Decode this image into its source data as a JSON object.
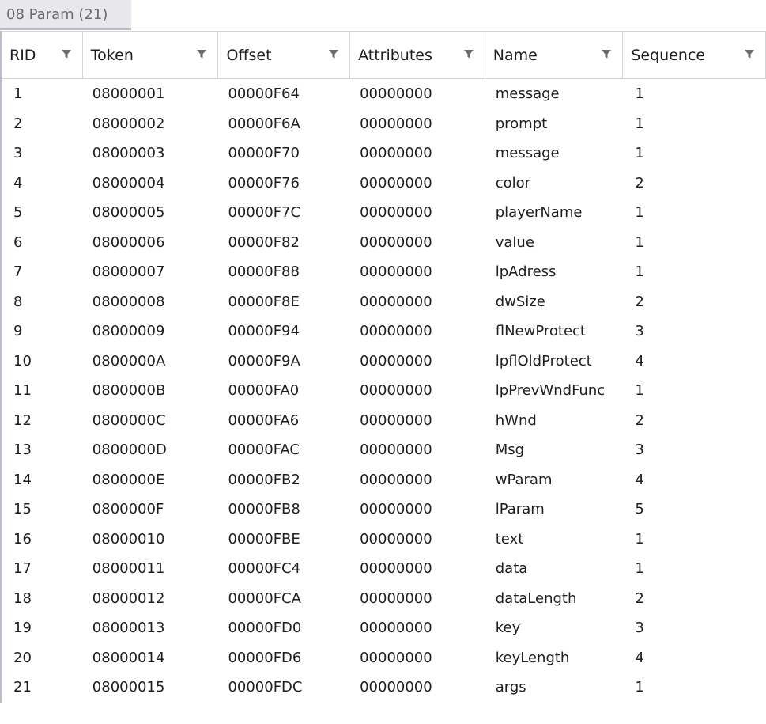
{
  "tab": {
    "label": "08 Param (21)"
  },
  "columns": [
    "RID",
    "Token",
    "Offset",
    "Attributes",
    "Name",
    "Sequence"
  ],
  "rows": [
    [
      "1",
      "08000001",
      "00000F64",
      "00000000",
      "message",
      "1"
    ],
    [
      "2",
      "08000002",
      "00000F6A",
      "00000000",
      "prompt",
      "1"
    ],
    [
      "3",
      "08000003",
      "00000F70",
      "00000000",
      "message",
      "1"
    ],
    [
      "4",
      "08000004",
      "00000F76",
      "00000000",
      "color",
      "2"
    ],
    [
      "5",
      "08000005",
      "00000F7C",
      "00000000",
      "playerName",
      "1"
    ],
    [
      "6",
      "08000006",
      "00000F82",
      "00000000",
      "value",
      "1"
    ],
    [
      "7",
      "08000007",
      "00000F88",
      "00000000",
      "lpAdress",
      "1"
    ],
    [
      "8",
      "08000008",
      "00000F8E",
      "00000000",
      "dwSize",
      "2"
    ],
    [
      "9",
      "08000009",
      "00000F94",
      "00000000",
      "flNewProtect",
      "3"
    ],
    [
      "10",
      "0800000A",
      "00000F9A",
      "00000000",
      "lpflOldProtect",
      "4"
    ],
    [
      "11",
      "0800000B",
      "00000FA0",
      "00000000",
      "lpPrevWndFunc",
      "1"
    ],
    [
      "12",
      "0800000C",
      "00000FA6",
      "00000000",
      "hWnd",
      "2"
    ],
    [
      "13",
      "0800000D",
      "00000FAC",
      "00000000",
      "Msg",
      "3"
    ],
    [
      "14",
      "0800000E",
      "00000FB2",
      "00000000",
      "wParam",
      "4"
    ],
    [
      "15",
      "0800000F",
      "00000FB8",
      "00000000",
      "lParam",
      "5"
    ],
    [
      "16",
      "08000010",
      "00000FBE",
      "00000000",
      "text",
      "1"
    ],
    [
      "17",
      "08000011",
      "00000FC4",
      "00000000",
      "data",
      "1"
    ],
    [
      "18",
      "08000012",
      "00000FCA",
      "00000000",
      "dataLength",
      "2"
    ],
    [
      "19",
      "08000013",
      "00000FD0",
      "00000000",
      "key",
      "3"
    ],
    [
      "20",
      "08000014",
      "00000FD6",
      "00000000",
      "keyLength",
      "4"
    ],
    [
      "21",
      "08000015",
      "00000FDC",
      "00000000",
      "args",
      "1"
    ]
  ],
  "icons": {
    "column_filter": "filter-icon"
  }
}
